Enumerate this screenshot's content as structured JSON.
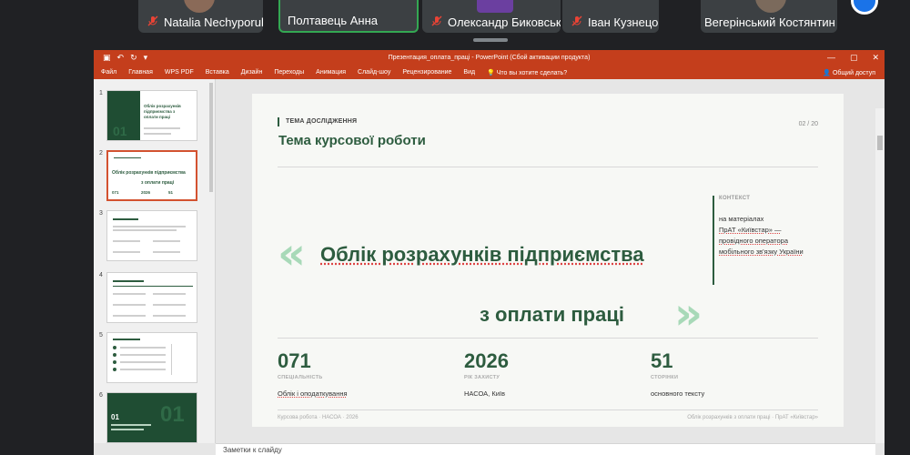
{
  "participants": [
    {
      "name": "Natalia Nechyporuk",
      "muted": true
    },
    {
      "name": "Полтавець Анна",
      "muted": false,
      "active": true
    },
    {
      "name": "Олександр Биковський",
      "muted": true
    },
    {
      "name": "Іван Кузнецов",
      "muted": true
    },
    {
      "name": "Вегерінський Костянтин",
      "muted": false
    }
  ],
  "window": {
    "title": "Презентация_оплата_праці - PowerPoint (Сбой активации продукта)",
    "controls": [
      "—",
      "▢",
      "✕"
    ]
  },
  "menu": {
    "items": [
      "Файл",
      "Главная",
      "WPS PDF",
      "Вставка",
      "Дизайн",
      "Переходы",
      "Анимация",
      "Слайд-шоу",
      "Рецензирование",
      "Вид"
    ],
    "tell_me": "Что вы хотите сделать?",
    "share": "Общий доступ"
  },
  "thumbnails": {
    "numbers": [
      "1",
      "2",
      "3",
      "4",
      "5",
      "6"
    ],
    "selected": 2,
    "slide1_text": "Облік розрахунків підприємства з оплати праці",
    "slide1_big": "01",
    "slide2_text": "Облік розрахунків підприємства",
    "slide2_sub": "з оплати праці",
    "slide2_stats": [
      "071",
      "2026",
      "51"
    ],
    "slide6_num": "01"
  },
  "slide": {
    "label": "ТЕМА ДОСЛІДЖЕННЯ",
    "title": "Тема курсової роботи",
    "page": "02 / 20",
    "main_line1": "Облік розрахунків підприємства",
    "main_line2": "з оплати праці",
    "context_label": "КОНТЕКСТ",
    "context_lines": [
      "на матеріалах",
      "ПрАТ «Київстар» —",
      "провідного оператора",
      "мобільного зв'язку України"
    ],
    "stats": [
      {
        "value": "071",
        "label": "СПЕЦІАЛЬНІСТЬ",
        "text": "Облік і оподаткування"
      },
      {
        "value": "2026",
        "label": "РІК ЗАХИСТУ",
        "text": "НАСОА, Київ"
      },
      {
        "value": "51",
        "label": "СТОРІНКИ",
        "text": "основного тексту"
      }
    ],
    "footer_left": "Курсова робота · НАСОА · 2026",
    "footer_right": "Облік розрахунків з оплати праці · ПрАТ «Київстар»"
  },
  "notes": "Заметки к слайду"
}
